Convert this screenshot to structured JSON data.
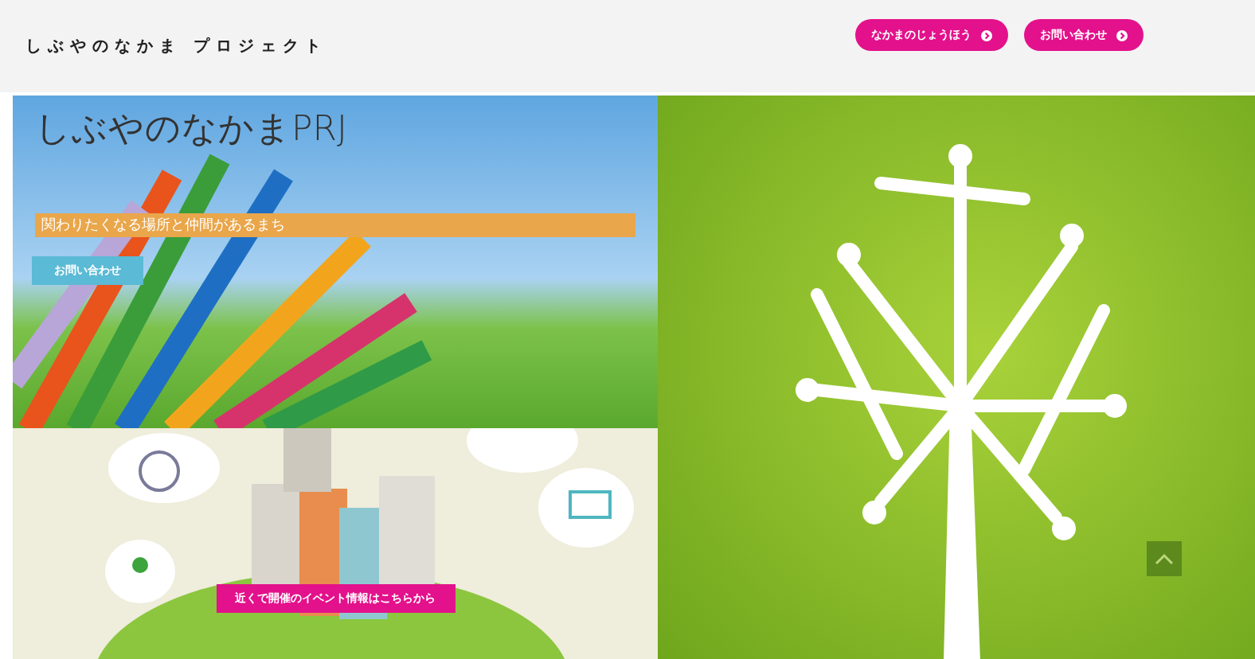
{
  "header": {
    "logo": "しぶやのなかま プロジェクト",
    "nav_buttons": [
      {
        "label": "なかまのじょうほう"
      },
      {
        "label": "お問い合わせ"
      }
    ]
  },
  "hero": {
    "title": "しぶやのなかまPRJ",
    "tagline": "関わりたくなる場所と仲間があるまち",
    "button": "お問い合わせ"
  },
  "event_panel": {
    "button": "近くで開催のイベント情報はこちらから"
  }
}
